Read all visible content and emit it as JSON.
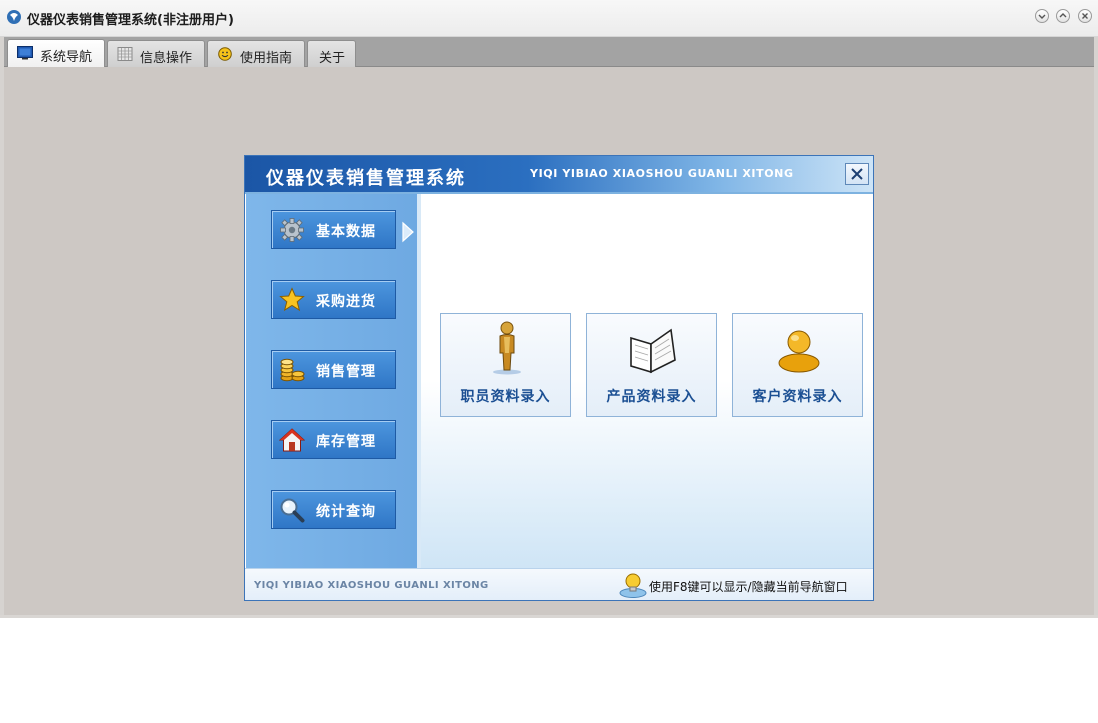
{
  "window": {
    "title": "仪器仪表销售管理系统(非注册用户)",
    "icon": "app-logo-icon",
    "controls": [
      "minimize-icon",
      "maximize-icon",
      "close-icon"
    ]
  },
  "tabs": [
    {
      "label": "系统导航",
      "icon": "monitor-icon",
      "active": true
    },
    {
      "label": "信息操作",
      "icon": "grid-icon",
      "active": false
    },
    {
      "label": "使用指南",
      "icon": "smiley-icon",
      "active": false
    },
    {
      "label": "关于",
      "icon": "",
      "active": false
    }
  ],
  "nav_window": {
    "title_cn": "仪器仪表销售管理系统",
    "title_en": "YIQI YIBIAO XIAOSHOU GUANLI XITONG",
    "sidebar": [
      {
        "label": "基本数据",
        "icon": "gear-icon",
        "selected": true
      },
      {
        "label": "采购进货",
        "icon": "star-icon",
        "selected": false
      },
      {
        "label": "销售管理",
        "icon": "coins-icon",
        "selected": false
      },
      {
        "label": "库存管理",
        "icon": "house-icon",
        "selected": false
      },
      {
        "label": "统计查询",
        "icon": "magnifier-icon",
        "selected": false
      }
    ],
    "cards": [
      {
        "label": "职员资料录入",
        "icon": "person-icon"
      },
      {
        "label": "产品资料录入",
        "icon": "book-icon"
      },
      {
        "label": "客户资料录入",
        "icon": "user-bust-icon"
      }
    ],
    "footer": {
      "en": "YIQI YIBIAO XIAOSHOU GUANLI XITONG",
      "tip": "使用F8键可以显示/隐藏当前导航窗口"
    }
  },
  "colors": {
    "header_blue": "#1b56a6",
    "sidebar_blue": "#7fb7ea",
    "button_blue": "#2f76c6",
    "card_text": "#1b4f93",
    "workspace_gray": "#cdc8c4"
  }
}
